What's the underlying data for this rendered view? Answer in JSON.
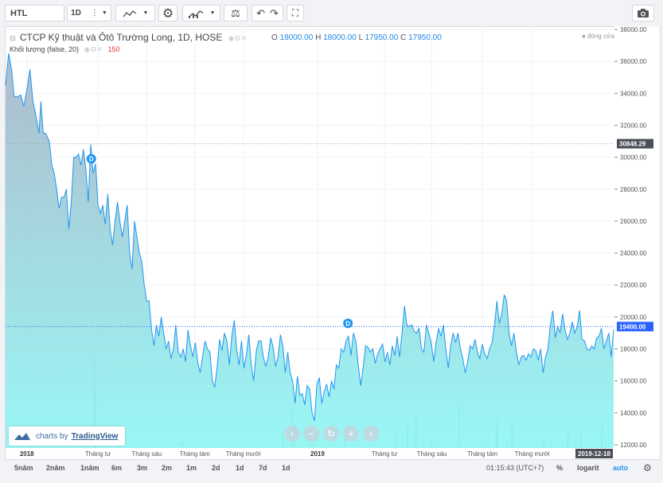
{
  "toolbar": {
    "symbol": "HTL",
    "interval": "1D",
    "icons": [
      "candles-icon",
      "chevron-down-icon",
      "indicators-icon",
      "chevron-down-icon",
      "gear-icon",
      "compare-icon",
      "chevron-down-icon",
      "scales-icon",
      "undo-icon",
      "redo-icon",
      "fullscreen-icon",
      "camera-icon"
    ]
  },
  "legend": {
    "title": "CTCP Kỹ thuật và Ôtô Trường Long, 1D, HOSE",
    "o_label": "O",
    "o": "18000.00",
    "h_label": "H",
    "h": "18000.00",
    "l_label": "L",
    "l": "17950.00",
    "c_label": "C",
    "c": "17950.00",
    "closed": "đóng cửa",
    "volume_label": "Khối lượng (false, 20)",
    "volume_value": "150"
  },
  "watermark": {
    "text": "charts by",
    "brand": "TradingView"
  },
  "bottom": {
    "ranges": [
      "5năm",
      "2năm",
      "1năm",
      "6m",
      "3m",
      "2m",
      "1m",
      "2d",
      "1d",
      "7d",
      "1d"
    ],
    "time": "01:15:43 (UTC+7)",
    "pct": "%",
    "log": "logarit",
    "auto": "auto"
  },
  "colors": {
    "line": "#2196f3",
    "area_top": "#a6b4c6",
    "area_bottom": "#8ef6f4",
    "volume": "#4caf50",
    "current": "#2962ff"
  },
  "chart_data": {
    "type": "area",
    "title": "CTCP Kỹ thuật và Ôtô Trường Long, 1D, HOSE",
    "ylim": [
      11800,
      38200
    ],
    "y_ticks": [
      12000,
      14000,
      16000,
      18000,
      20000,
      22000,
      24000,
      26000,
      28000,
      30000,
      32000,
      34000,
      36000,
      38000
    ],
    "y_tick_labels": [
      "12000.00",
      "14000.00",
      "16000.00",
      "18000.00",
      "20000.00",
      "22000.00",
      "24000.00",
      "26000.00",
      "28000.00",
      "30000.00",
      "32000.00",
      "34000.00",
      "36000.00",
      "38000.00"
    ],
    "x_labels": [
      {
        "t": 0.035,
        "label": "2018",
        "bold": true
      },
      {
        "t": 0.152,
        "label": "Tháng tư"
      },
      {
        "t": 0.232,
        "label": "Tháng sáu"
      },
      {
        "t": 0.311,
        "label": "Tháng tám"
      },
      {
        "t": 0.391,
        "label": "Tháng mười"
      },
      {
        "t": 0.513,
        "label": "2019",
        "bold": true
      },
      {
        "t": 0.623,
        "label": "Tháng tư"
      },
      {
        "t": 0.701,
        "label": "Tháng sáu"
      },
      {
        "t": 0.784,
        "label": "Tháng tám"
      },
      {
        "t": 0.866,
        "label": "Tháng mười"
      }
    ],
    "last_date": "2019-12-18",
    "series": [
      {
        "values": [
          [
            0.0,
            34500
          ],
          [
            0.005,
            36500
          ],
          [
            0.01,
            35500
          ],
          [
            0.014,
            33800
          ],
          [
            0.02,
            33800
          ],
          [
            0.025,
            33900
          ],
          [
            0.03,
            33200
          ],
          [
            0.035,
            34200
          ],
          [
            0.04,
            35500
          ],
          [
            0.045,
            33500
          ],
          [
            0.05,
            32600
          ],
          [
            0.055,
            31500
          ],
          [
            0.058,
            33500
          ],
          [
            0.062,
            31500
          ],
          [
            0.066,
            31500
          ],
          [
            0.072,
            31000
          ],
          [
            0.076,
            29500
          ],
          [
            0.08,
            29000
          ],
          [
            0.084,
            28000
          ],
          [
            0.088,
            26800
          ],
          [
            0.092,
            27500
          ],
          [
            0.096,
            27500
          ],
          [
            0.1,
            28000
          ],
          [
            0.104,
            25500
          ],
          [
            0.108,
            27200
          ],
          [
            0.112,
            30000
          ],
          [
            0.116,
            30000
          ],
          [
            0.12,
            30200
          ],
          [
            0.124,
            29500
          ],
          [
            0.128,
            30500
          ],
          [
            0.132,
            29300
          ],
          [
            0.136,
            27200
          ],
          [
            0.14,
            30800
          ],
          [
            0.144,
            29000
          ],
          [
            0.148,
            29600
          ],
          [
            0.152,
            27000
          ],
          [
            0.156,
            26500
          ],
          [
            0.16,
            27000
          ],
          [
            0.164,
            25800
          ],
          [
            0.168,
            27700
          ],
          [
            0.172,
            25500
          ],
          [
            0.176,
            24500
          ],
          [
            0.18,
            26000
          ],
          [
            0.184,
            27200
          ],
          [
            0.188,
            26000
          ],
          [
            0.192,
            25000
          ],
          [
            0.196,
            26000
          ],
          [
            0.2,
            27000
          ],
          [
            0.204,
            24000
          ],
          [
            0.208,
            23000
          ],
          [
            0.212,
            26000
          ],
          [
            0.216,
            25000
          ],
          [
            0.22,
            24000
          ],
          [
            0.224,
            23500
          ],
          [
            0.228,
            22000
          ],
          [
            0.232,
            21000
          ],
          [
            0.236,
            21000
          ],
          [
            0.24,
            19200
          ],
          [
            0.244,
            18200
          ],
          [
            0.248,
            19500
          ],
          [
            0.252,
            18800
          ],
          [
            0.256,
            20000
          ],
          [
            0.26,
            19000
          ],
          [
            0.264,
            18000
          ],
          [
            0.268,
            18500
          ],
          [
            0.272,
            17400
          ],
          [
            0.276,
            18000
          ],
          [
            0.28,
            19500
          ],
          [
            0.284,
            17800
          ],
          [
            0.288,
            17500
          ],
          [
            0.292,
            18000
          ],
          [
            0.296,
            17200
          ],
          [
            0.3,
            19200
          ],
          [
            0.304,
            18200
          ],
          [
            0.308,
            17500
          ],
          [
            0.312,
            18400
          ],
          [
            0.316,
            17200
          ],
          [
            0.32,
            16500
          ],
          [
            0.324,
            17500
          ],
          [
            0.328,
            18500
          ],
          [
            0.332,
            18000
          ],
          [
            0.336,
            17800
          ],
          [
            0.34,
            16000
          ],
          [
            0.344,
            15600
          ],
          [
            0.348,
            16900
          ],
          [
            0.352,
            18600
          ],
          [
            0.356,
            17900
          ],
          [
            0.36,
            19000
          ],
          [
            0.364,
            18500
          ],
          [
            0.368,
            17000
          ],
          [
            0.372,
            18800
          ],
          [
            0.376,
            19800
          ],
          [
            0.38,
            18000
          ],
          [
            0.384,
            17000
          ],
          [
            0.388,
            18500
          ],
          [
            0.392,
            16800
          ],
          [
            0.396,
            17600
          ],
          [
            0.4,
            18900
          ],
          [
            0.404,
            17000
          ],
          [
            0.408,
            16000
          ],
          [
            0.412,
            17800
          ],
          [
            0.416,
            18500
          ],
          [
            0.42,
            18500
          ],
          [
            0.424,
            17500
          ],
          [
            0.428,
            16900
          ],
          [
            0.432,
            17500
          ],
          [
            0.436,
            18700
          ],
          [
            0.44,
            18100
          ],
          [
            0.444,
            16900
          ],
          [
            0.448,
            17500
          ],
          [
            0.452,
            18900
          ],
          [
            0.456,
            18200
          ],
          [
            0.46,
            16500
          ],
          [
            0.464,
            17800
          ],
          [
            0.468,
            16500
          ],
          [
            0.472,
            16000
          ],
          [
            0.476,
            14600
          ],
          [
            0.48,
            16300
          ],
          [
            0.484,
            15100
          ],
          [
            0.488,
            15200
          ],
          [
            0.492,
            14500
          ],
          [
            0.496,
            15700
          ],
          [
            0.5,
            15500
          ],
          [
            0.504,
            14000
          ],
          [
            0.508,
            13500
          ],
          [
            0.512,
            15800
          ],
          [
            0.516,
            16200
          ],
          [
            0.52,
            14600
          ],
          [
            0.524,
            15300
          ],
          [
            0.528,
            15800
          ],
          [
            0.532,
            15000
          ],
          [
            0.536,
            16000
          ],
          [
            0.54,
            15500
          ],
          [
            0.544,
            17000
          ],
          [
            0.548,
            16800
          ],
          [
            0.552,
            18000
          ],
          [
            0.556,
            17800
          ],
          [
            0.56,
            18500
          ],
          [
            0.564,
            18800
          ],
          [
            0.568,
            17600
          ],
          [
            0.572,
            19000
          ],
          [
            0.576,
            18500
          ],
          [
            0.58,
            17000
          ],
          [
            0.584,
            15700
          ],
          [
            0.588,
            16800
          ],
          [
            0.592,
            18200
          ],
          [
            0.596,
            18100
          ],
          [
            0.6,
            17800
          ],
          [
            0.604,
            18000
          ],
          [
            0.608,
            17100
          ],
          [
            0.612,
            17700
          ],
          [
            0.616,
            18000
          ],
          [
            0.62,
            18300
          ],
          [
            0.624,
            17200
          ],
          [
            0.628,
            17800
          ],
          [
            0.632,
            17000
          ],
          [
            0.636,
            18200
          ],
          [
            0.64,
            17600
          ],
          [
            0.644,
            18800
          ],
          [
            0.648,
            17500
          ],
          [
            0.652,
            19000
          ],
          [
            0.656,
            20700
          ],
          [
            0.66,
            19500
          ],
          [
            0.664,
            19400
          ],
          [
            0.668,
            19500
          ],
          [
            0.672,
            19100
          ],
          [
            0.676,
            19000
          ],
          [
            0.68,
            19300
          ],
          [
            0.684,
            18000
          ],
          [
            0.688,
            17800
          ],
          [
            0.692,
            19500
          ],
          [
            0.696,
            19000
          ],
          [
            0.7,
            18400
          ],
          [
            0.704,
            17200
          ],
          [
            0.708,
            18400
          ],
          [
            0.712,
            19300
          ],
          [
            0.716,
            18800
          ],
          [
            0.72,
            19500
          ],
          [
            0.724,
            18000
          ],
          [
            0.728,
            16800
          ],
          [
            0.732,
            18200
          ],
          [
            0.736,
            19000
          ],
          [
            0.74,
            18400
          ],
          [
            0.744,
            19000
          ],
          [
            0.748,
            18000
          ],
          [
            0.752,
            17400
          ],
          [
            0.756,
            16500
          ],
          [
            0.76,
            17200
          ],
          [
            0.764,
            18200
          ],
          [
            0.768,
            18000
          ],
          [
            0.772,
            18600
          ],
          [
            0.776,
            17800
          ],
          [
            0.78,
            17400
          ],
          [
            0.784,
            18300
          ],
          [
            0.788,
            17700
          ],
          [
            0.792,
            17400
          ],
          [
            0.796,
            18000
          ],
          [
            0.8,
            18400
          ],
          [
            0.804,
            19500
          ],
          [
            0.808,
            21000
          ],
          [
            0.812,
            19600
          ],
          [
            0.816,
            20200
          ],
          [
            0.82,
            21400
          ],
          [
            0.824,
            21000
          ],
          [
            0.828,
            19000
          ],
          [
            0.832,
            18200
          ],
          [
            0.836,
            19000
          ],
          [
            0.84,
            17800
          ],
          [
            0.844,
            17000
          ],
          [
            0.848,
            17500
          ],
          [
            0.852,
            17600
          ],
          [
            0.856,
            17300
          ],
          [
            0.86,
            17700
          ],
          [
            0.864,
            17500
          ],
          [
            0.868,
            18000
          ],
          [
            0.872,
            17900
          ],
          [
            0.876,
            17300
          ],
          [
            0.88,
            18000
          ],
          [
            0.884,
            16500
          ],
          [
            0.888,
            17500
          ],
          [
            0.892,
            18000
          ],
          [
            0.896,
            19500
          ],
          [
            0.9,
            20400
          ],
          [
            0.904,
            18700
          ],
          [
            0.908,
            19400
          ],
          [
            0.912,
            19000
          ],
          [
            0.916,
            20200
          ],
          [
            0.92,
            19200
          ],
          [
            0.924,
            18600
          ],
          [
            0.928,
            19000
          ],
          [
            0.932,
            19700
          ],
          [
            0.936,
            19000
          ],
          [
            0.94,
            19400
          ],
          [
            0.944,
            20400
          ],
          [
            0.948,
            18600
          ],
          [
            0.952,
            18500
          ],
          [
            0.956,
            18000
          ],
          [
            0.96,
            17900
          ],
          [
            0.964,
            18200
          ],
          [
            0.968,
            18000
          ],
          [
            0.972,
            18700
          ],
          [
            0.976,
            18800
          ],
          [
            0.98,
            19300
          ],
          [
            0.984,
            18000
          ],
          [
            0.988,
            18500
          ],
          [
            0.992,
            19000
          ],
          [
            0.996,
            17500
          ],
          [
            1.0,
            19200
          ]
        ]
      }
    ],
    "current_price": 19400,
    "current_label": "19400.00",
    "marker_price": 30848.29,
    "marker_label": "30848.29",
    "dividend_markers": [
      {
        "t": 0.141,
        "price": 29900,
        "label": "D"
      },
      {
        "t": 0.563,
        "price": 19600,
        "label": "D"
      }
    ],
    "volume_bars": [
      {
        "t": 0.145,
        "v": 0.75
      },
      {
        "t": 0.147,
        "v": 0.45
      },
      {
        "t": 0.128,
        "v": 0.12
      },
      {
        "t": 0.195,
        "v": 0.1
      },
      {
        "t": 0.29,
        "v": 0.06
      },
      {
        "t": 0.455,
        "v": 0.15
      },
      {
        "t": 0.475,
        "v": 0.2
      },
      {
        "t": 0.47,
        "v": 0.32
      },
      {
        "t": 0.5,
        "v": 0.18
      },
      {
        "t": 0.557,
        "v": 0.08
      },
      {
        "t": 0.64,
        "v": 0.12
      },
      {
        "t": 0.66,
        "v": 0.2
      },
      {
        "t": 0.674,
        "v": 0.3
      },
      {
        "t": 0.7,
        "v": 0.08
      },
      {
        "t": 0.745,
        "v": 0.35
      },
      {
        "t": 0.806,
        "v": 0.15
      },
      {
        "t": 0.808,
        "v": 0.25
      },
      {
        "t": 0.832,
        "v": 0.2
      },
      {
        "t": 0.884,
        "v": 0.08
      },
      {
        "t": 0.924,
        "v": 0.15
      },
      {
        "t": 0.945,
        "v": 0.12
      },
      {
        "t": 0.98,
        "v": 0.2
      }
    ]
  }
}
